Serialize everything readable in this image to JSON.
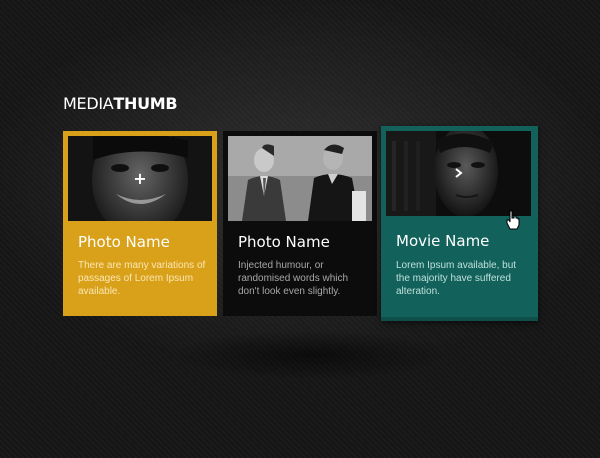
{
  "header": {
    "title_light": "MEDIA",
    "title_bold": "THUMB"
  },
  "cards": [
    {
      "title": "Photo Name",
      "description": "There are many variations of passages of Lorem Ipsum available.",
      "icon": "plus-icon",
      "color": "#d9a01a"
    },
    {
      "title": "Photo Name",
      "description": "Injected humour, or randomised words which don't look even slightly.",
      "color": "#0c0c0c"
    },
    {
      "title": "Movie Name",
      "description": "Lorem Ipsum available, but the majority have suffered alteration.",
      "icon": "play-arrow-icon",
      "color": "#12615b"
    }
  ]
}
